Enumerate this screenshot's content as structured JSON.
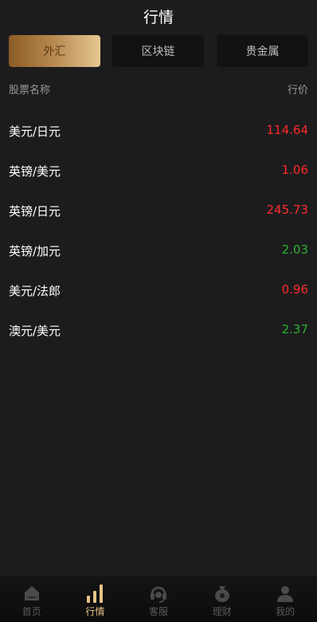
{
  "header": {
    "title": "行情"
  },
  "tabs": [
    {
      "label": "外汇",
      "active": true
    },
    {
      "label": "区块链",
      "active": false
    },
    {
      "label": "贵金属",
      "active": false
    }
  ],
  "columns": {
    "name": "股票名称",
    "price": "行价"
  },
  "rows": [
    {
      "name": "美元/日元",
      "price": "114.64",
      "trend": "up"
    },
    {
      "name": "英镑/美元",
      "price": "1.06",
      "trend": "up"
    },
    {
      "name": "英镑/日元",
      "price": "245.73",
      "trend": "up"
    },
    {
      "name": "英镑/加元",
      "price": "2.03",
      "trend": "down"
    },
    {
      "name": "美元/法郎",
      "price": "0.96",
      "trend": "up"
    },
    {
      "name": "澳元/美元",
      "price": "2.37",
      "trend": "down"
    }
  ],
  "tabbar": [
    {
      "label": "首页",
      "icon": "home-icon"
    },
    {
      "label": "行情",
      "icon": "bar-chart-icon",
      "active": true
    },
    {
      "label": "客服",
      "icon": "headset-icon"
    },
    {
      "label": "理财",
      "icon": "money-bag-icon"
    },
    {
      "label": "我的",
      "icon": "user-icon"
    }
  ],
  "colors": {
    "up": "#ff2a2a",
    "down": "#2db22d",
    "accent": "#e6c387"
  }
}
